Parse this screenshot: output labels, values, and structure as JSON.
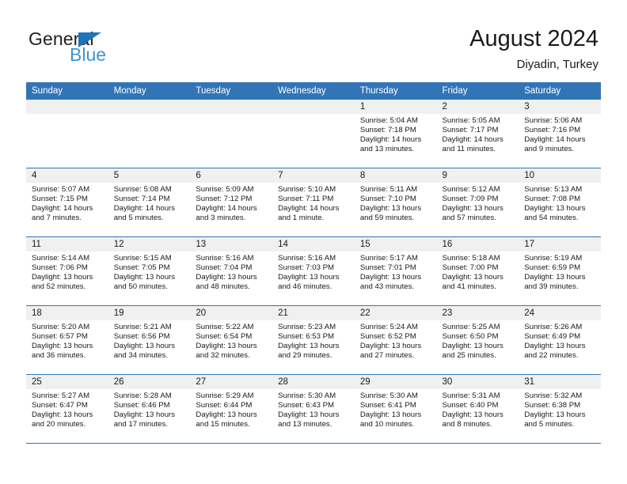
{
  "brand": {
    "name_part1": "General",
    "name_part2": "Blue",
    "triangle_color": "#1b75bb",
    "blue_color": "#3d95d4"
  },
  "header": {
    "title": "August 2024",
    "subtitle": "Diyadin, Turkey"
  },
  "theme": {
    "header_bg": "#3275b7",
    "date_band_bg": "#f0f0f0",
    "row_border": "#3275b7",
    "text": "#1a1a1a"
  },
  "weekdays": [
    "Sunday",
    "Monday",
    "Tuesday",
    "Wednesday",
    "Thursday",
    "Friday",
    "Saturday"
  ],
  "weeks": [
    [
      {
        "day": "",
        "empty": true,
        "sunrise": "",
        "sunset": "",
        "daylight1": "",
        "daylight2": ""
      },
      {
        "day": "",
        "empty": true,
        "sunrise": "",
        "sunset": "",
        "daylight1": "",
        "daylight2": ""
      },
      {
        "day": "",
        "empty": true,
        "sunrise": "",
        "sunset": "",
        "daylight1": "",
        "daylight2": ""
      },
      {
        "day": "",
        "empty": true,
        "sunrise": "",
        "sunset": "",
        "daylight1": "",
        "daylight2": ""
      },
      {
        "day": "1",
        "empty": false,
        "sunrise": "Sunrise: 5:04 AM",
        "sunset": "Sunset: 7:18 PM",
        "daylight1": "Daylight: 14 hours",
        "daylight2": "and 13 minutes."
      },
      {
        "day": "2",
        "empty": false,
        "sunrise": "Sunrise: 5:05 AM",
        "sunset": "Sunset: 7:17 PM",
        "daylight1": "Daylight: 14 hours",
        "daylight2": "and 11 minutes."
      },
      {
        "day": "3",
        "empty": false,
        "sunrise": "Sunrise: 5:06 AM",
        "sunset": "Sunset: 7:16 PM",
        "daylight1": "Daylight: 14 hours",
        "daylight2": "and 9 minutes."
      }
    ],
    [
      {
        "day": "4",
        "empty": false,
        "sunrise": "Sunrise: 5:07 AM",
        "sunset": "Sunset: 7:15 PM",
        "daylight1": "Daylight: 14 hours",
        "daylight2": "and 7 minutes."
      },
      {
        "day": "5",
        "empty": false,
        "sunrise": "Sunrise: 5:08 AM",
        "sunset": "Sunset: 7:14 PM",
        "daylight1": "Daylight: 14 hours",
        "daylight2": "and 5 minutes."
      },
      {
        "day": "6",
        "empty": false,
        "sunrise": "Sunrise: 5:09 AM",
        "sunset": "Sunset: 7:12 PM",
        "daylight1": "Daylight: 14 hours",
        "daylight2": "and 3 minutes."
      },
      {
        "day": "7",
        "empty": false,
        "sunrise": "Sunrise: 5:10 AM",
        "sunset": "Sunset: 7:11 PM",
        "daylight1": "Daylight: 14 hours",
        "daylight2": "and 1 minute."
      },
      {
        "day": "8",
        "empty": false,
        "sunrise": "Sunrise: 5:11 AM",
        "sunset": "Sunset: 7:10 PM",
        "daylight1": "Daylight: 13 hours",
        "daylight2": "and 59 minutes."
      },
      {
        "day": "9",
        "empty": false,
        "sunrise": "Sunrise: 5:12 AM",
        "sunset": "Sunset: 7:09 PM",
        "daylight1": "Daylight: 13 hours",
        "daylight2": "and 57 minutes."
      },
      {
        "day": "10",
        "empty": false,
        "sunrise": "Sunrise: 5:13 AM",
        "sunset": "Sunset: 7:08 PM",
        "daylight1": "Daylight: 13 hours",
        "daylight2": "and 54 minutes."
      }
    ],
    [
      {
        "day": "11",
        "empty": false,
        "sunrise": "Sunrise: 5:14 AM",
        "sunset": "Sunset: 7:06 PM",
        "daylight1": "Daylight: 13 hours",
        "daylight2": "and 52 minutes."
      },
      {
        "day": "12",
        "empty": false,
        "sunrise": "Sunrise: 5:15 AM",
        "sunset": "Sunset: 7:05 PM",
        "daylight1": "Daylight: 13 hours",
        "daylight2": "and 50 minutes."
      },
      {
        "day": "13",
        "empty": false,
        "sunrise": "Sunrise: 5:16 AM",
        "sunset": "Sunset: 7:04 PM",
        "daylight1": "Daylight: 13 hours",
        "daylight2": "and 48 minutes."
      },
      {
        "day": "14",
        "empty": false,
        "sunrise": "Sunrise: 5:16 AM",
        "sunset": "Sunset: 7:03 PM",
        "daylight1": "Daylight: 13 hours",
        "daylight2": "and 46 minutes."
      },
      {
        "day": "15",
        "empty": false,
        "sunrise": "Sunrise: 5:17 AM",
        "sunset": "Sunset: 7:01 PM",
        "daylight1": "Daylight: 13 hours",
        "daylight2": "and 43 minutes."
      },
      {
        "day": "16",
        "empty": false,
        "sunrise": "Sunrise: 5:18 AM",
        "sunset": "Sunset: 7:00 PM",
        "daylight1": "Daylight: 13 hours",
        "daylight2": "and 41 minutes."
      },
      {
        "day": "17",
        "empty": false,
        "sunrise": "Sunrise: 5:19 AM",
        "sunset": "Sunset: 6:59 PM",
        "daylight1": "Daylight: 13 hours",
        "daylight2": "and 39 minutes."
      }
    ],
    [
      {
        "day": "18",
        "empty": false,
        "sunrise": "Sunrise: 5:20 AM",
        "sunset": "Sunset: 6:57 PM",
        "daylight1": "Daylight: 13 hours",
        "daylight2": "and 36 minutes."
      },
      {
        "day": "19",
        "empty": false,
        "sunrise": "Sunrise: 5:21 AM",
        "sunset": "Sunset: 6:56 PM",
        "daylight1": "Daylight: 13 hours",
        "daylight2": "and 34 minutes."
      },
      {
        "day": "20",
        "empty": false,
        "sunrise": "Sunrise: 5:22 AM",
        "sunset": "Sunset: 6:54 PM",
        "daylight1": "Daylight: 13 hours",
        "daylight2": "and 32 minutes."
      },
      {
        "day": "21",
        "empty": false,
        "sunrise": "Sunrise: 5:23 AM",
        "sunset": "Sunset: 6:53 PM",
        "daylight1": "Daylight: 13 hours",
        "daylight2": "and 29 minutes."
      },
      {
        "day": "22",
        "empty": false,
        "sunrise": "Sunrise: 5:24 AM",
        "sunset": "Sunset: 6:52 PM",
        "daylight1": "Daylight: 13 hours",
        "daylight2": "and 27 minutes."
      },
      {
        "day": "23",
        "empty": false,
        "sunrise": "Sunrise: 5:25 AM",
        "sunset": "Sunset: 6:50 PM",
        "daylight1": "Daylight: 13 hours",
        "daylight2": "and 25 minutes."
      },
      {
        "day": "24",
        "empty": false,
        "sunrise": "Sunrise: 5:26 AM",
        "sunset": "Sunset: 6:49 PM",
        "daylight1": "Daylight: 13 hours",
        "daylight2": "and 22 minutes."
      }
    ],
    [
      {
        "day": "25",
        "empty": false,
        "sunrise": "Sunrise: 5:27 AM",
        "sunset": "Sunset: 6:47 PM",
        "daylight1": "Daylight: 13 hours",
        "daylight2": "and 20 minutes."
      },
      {
        "day": "26",
        "empty": false,
        "sunrise": "Sunrise: 5:28 AM",
        "sunset": "Sunset: 6:46 PM",
        "daylight1": "Daylight: 13 hours",
        "daylight2": "and 17 minutes."
      },
      {
        "day": "27",
        "empty": false,
        "sunrise": "Sunrise: 5:29 AM",
        "sunset": "Sunset: 6:44 PM",
        "daylight1": "Daylight: 13 hours",
        "daylight2": "and 15 minutes."
      },
      {
        "day": "28",
        "empty": false,
        "sunrise": "Sunrise: 5:30 AM",
        "sunset": "Sunset: 6:43 PM",
        "daylight1": "Daylight: 13 hours",
        "daylight2": "and 13 minutes."
      },
      {
        "day": "29",
        "empty": false,
        "sunrise": "Sunrise: 5:30 AM",
        "sunset": "Sunset: 6:41 PM",
        "daylight1": "Daylight: 13 hours",
        "daylight2": "and 10 minutes."
      },
      {
        "day": "30",
        "empty": false,
        "sunrise": "Sunrise: 5:31 AM",
        "sunset": "Sunset: 6:40 PM",
        "daylight1": "Daylight: 13 hours",
        "daylight2": "and 8 minutes."
      },
      {
        "day": "31",
        "empty": false,
        "sunrise": "Sunrise: 5:32 AM",
        "sunset": "Sunset: 6:38 PM",
        "daylight1": "Daylight: 13 hours",
        "daylight2": "and 5 minutes."
      }
    ]
  ]
}
